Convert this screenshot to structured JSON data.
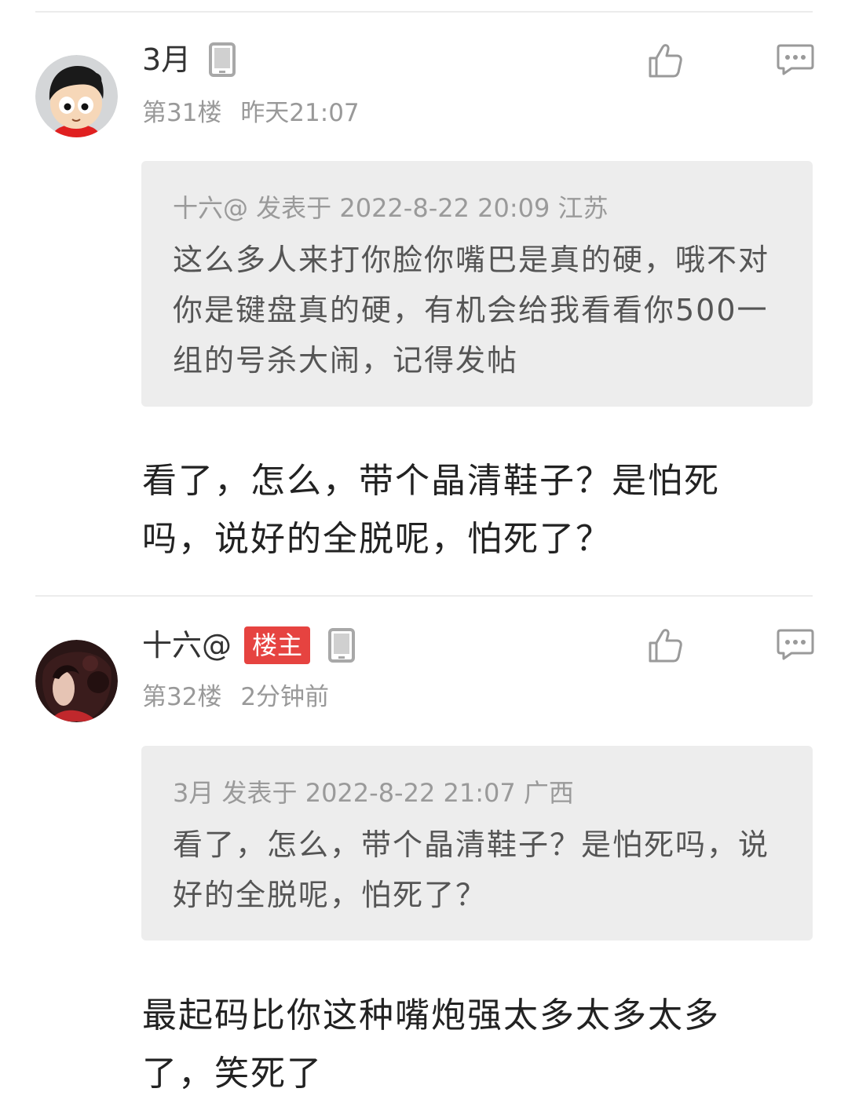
{
  "posts": [
    {
      "username": "3月",
      "is_op": false,
      "floor": "第31楼",
      "time": "昨天21:07",
      "quote": {
        "header": "十六@ 发表于 2022-8-22 20:09 江苏",
        "body": "这么多人来打你脸你嘴巴是真的硬，哦不对你是键盘真的硬，有机会给我看看你500一组的号杀大闹，记得发帖"
      },
      "content": "看了，怎么，带个晶清鞋子？是怕死吗，说好的全脱呢，怕死了？"
    },
    {
      "username": "十六@",
      "is_op": true,
      "op_badge": "楼主",
      "floor": "第32楼",
      "time": "2分钟前",
      "quote": {
        "header": "3月 发表于 2022-8-22 21:07 广西",
        "body": "看了，怎么，带个晶清鞋子？是怕死吗，说好的全脱呢，怕死了？"
      },
      "content": "最起码比你这种嘴炮强太多太多太多了，笑死了"
    }
  ],
  "icons": {
    "device": "mobile-phone-icon",
    "like": "thumbs-up-icon",
    "reply": "comment-bubble-icon"
  },
  "colors": {
    "op_badge": "#e64340",
    "meta_text": "#999999",
    "quote_bg": "#ededed"
  }
}
